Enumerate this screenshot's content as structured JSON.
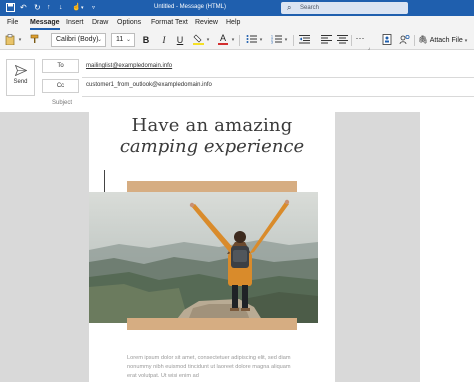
{
  "window": {
    "title": "Untitled  -  Message (HTML)",
    "search_placeholder": "Search"
  },
  "menu": {
    "items": [
      "File",
      "Message",
      "Insert",
      "Draw",
      "Options",
      "Format Text",
      "Review",
      "Help"
    ],
    "active": "Message"
  },
  "ribbon": {
    "font_name": "Calibri (Body)",
    "font_size": "11",
    "bold_label": "B",
    "italic_label": "I",
    "underline_label": "U",
    "font_color_label": "A",
    "more_label": "···",
    "attach_label": "Attach File",
    "highlight_color": "#f5e026",
    "font_color": "#d32f2f"
  },
  "compose": {
    "send_label": "Send",
    "to_label": "To",
    "to_value": "mailinglist@exampledomain.info",
    "cc_label": "Cc",
    "cc_value": "customer1_from_outlook@exampledomain.info",
    "subject_label": "Subject"
  },
  "body": {
    "headline_line1": "Have an amazing",
    "headline_line2": "camping experience",
    "lorem": "Lorem ipsum dolor sit amet, consectetuer adipiscing elit, sed diam nonummy nibh euismod tincidunt ut laoreet dolore magna aliquam erat volutpat. Ut wisi enim ad",
    "accent_color": "#d6ad82"
  }
}
